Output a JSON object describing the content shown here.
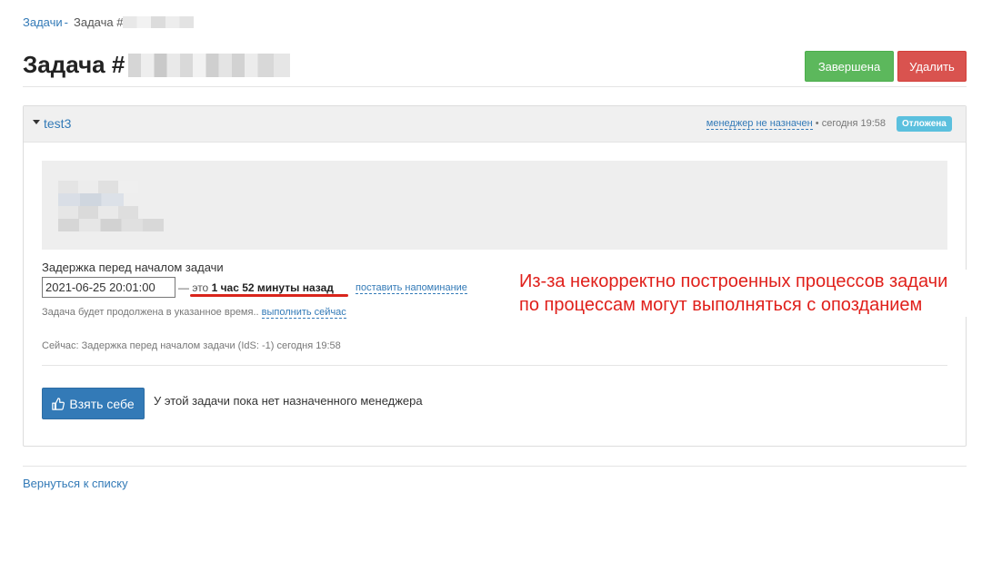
{
  "breadcrumb": {
    "parent": "Задачи",
    "separator": "-",
    "current": "Задача #"
  },
  "page": {
    "title": "Задача #"
  },
  "actions": {
    "complete_label": "Завершена",
    "delete_label": "Удалить"
  },
  "task": {
    "name": "test3",
    "manager_link": "менеджер не назначен",
    "time_sep": "•",
    "time": "сегодня 19:58",
    "status_badge": "Отложена",
    "delay_label": "Задержка перед началом задачи",
    "delay_value": "2021-06-25 20:01:00",
    "delay_prefix": "— это",
    "delay_relative": "1 час 52 минуты назад",
    "remind_link": "поставить напоминание",
    "continue_note": "Задача будет продолжена в указанное время..",
    "run_now_link": "выполнить сейчас",
    "now_status": "Сейчас: Задержка перед началом задачи (IdS: -1) сегодня 19:58",
    "take_button": "Взять себе",
    "no_manager_text": "У этой задачи пока нет назначенного менеджера"
  },
  "annotation": {
    "line1": "Из-за некорректно построенных процессов задачи",
    "line2": "по процессам могут выполняться с опозданием"
  },
  "footer": {
    "back_link": "Вернуться к списку"
  },
  "colors": {
    "primary": "#337ab7",
    "success": "#5cb85c",
    "danger": "#d9534f",
    "info": "#5bc0de",
    "annotation": "#e0201b"
  },
  "icons": {
    "collapse": "caret-down-icon",
    "take": "thumbs-up-icon"
  }
}
